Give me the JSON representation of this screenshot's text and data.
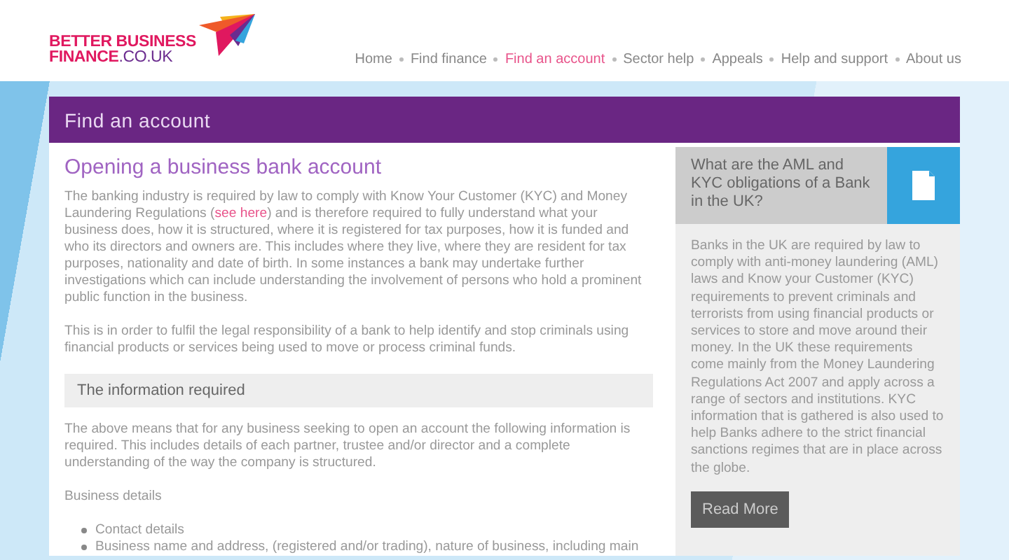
{
  "logo": {
    "line1": "BETTER BUSINESS",
    "line2": "FINANCE",
    "line2_suffix": ".CO.UK"
  },
  "nav": [
    {
      "label": "Home",
      "selected": false
    },
    {
      "label": "Find finance",
      "selected": false
    },
    {
      "label": "Find an account",
      "selected": true
    },
    {
      "label": "Sector help",
      "selected": false
    },
    {
      "label": "Appeals",
      "selected": false
    },
    {
      "label": "Help and support",
      "selected": false
    },
    {
      "label": "About us",
      "selected": false
    }
  ],
  "page_title": "Find an account",
  "article": {
    "heading": "Opening a business bank account",
    "intro": {
      "before": "The banking industry is required by law to comply with Know Your Customer (KYC) and Money Laundering Regulations (",
      "link": "see here",
      "after": ") and is therefore required to fully understand what your business does, how it is structured, where it is registered for tax purposes, how it is funded and who its directors and owners are. This includes where they live, where they are resident for tax purposes, nationality and date of birth. In some instances a bank may undertake further investigations which can include understanding the involvement of persons who hold a prominent public function in the business."
    },
    "paragraph": "This is in order to fulfil the legal responsibility of a bank to help identify and stop criminals using financial products or services being used to move or process criminal funds.",
    "section_heading": "The information required",
    "section_text": "The above means that for any business seeking to open an account the following information is required. This includes details of each partner, trustee and/or director and a complete understanding of the way the company is structured.",
    "subheading": "Business details",
    "bullets": [
      "Contact details",
      "Business name and address, (registered and/or trading), nature of business, including main"
    ]
  },
  "sidebar": {
    "question": "What are the AML and KYC obligations of a Bank in the UK?",
    "text": "Banks in the UK are required by law to comply with anti-money laundering (AML) laws and Know your Customer (KYC) requirements to prevent criminals and terrorists from using financial products or services to store and move around their money. In the UK these requirements come mainly from the Money Laundering Regulations Act 2007 and apply across a range of sectors and institutions. KYC information that is gathered is also used to help Banks adhere to the strict financial sanctions regimes that are in place across the globe.",
    "button": "Read More"
  }
}
